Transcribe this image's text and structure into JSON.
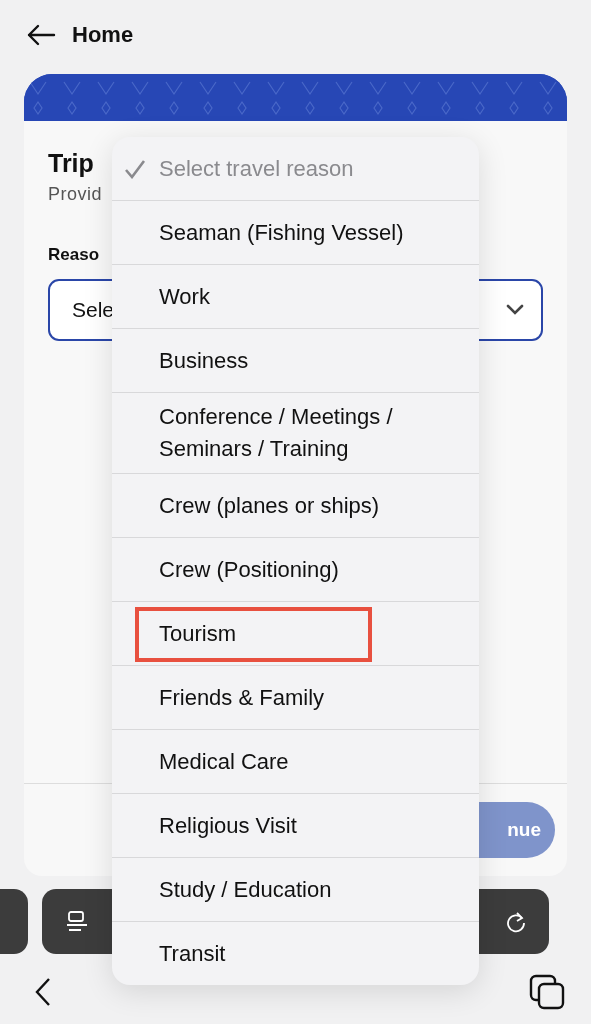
{
  "header": {
    "back_label": "Home"
  },
  "form": {
    "title": "Trip",
    "subtitle": "Provid",
    "field_label": "Reaso",
    "select_value": "Sele"
  },
  "continue_button": {
    "label": "nue",
    "disabled": true
  },
  "menu": {
    "items": [
      {
        "label": "Select travel reason",
        "kind": "placeholder",
        "selected": true,
        "highlighted": false
      },
      {
        "label": "Seaman (Fishing Vessel)",
        "kind": "option",
        "selected": false,
        "highlighted": false
      },
      {
        "label": "Work",
        "kind": "option",
        "selected": false,
        "highlighted": false
      },
      {
        "label": "Business",
        "kind": "option",
        "selected": false,
        "highlighted": false
      },
      {
        "label": "Conference / Meetings / Seminars / Training",
        "kind": "option",
        "selected": false,
        "highlighted": false
      },
      {
        "label": "Crew (planes or ships)",
        "kind": "option",
        "selected": false,
        "highlighted": false
      },
      {
        "label": "Crew (Positioning)",
        "kind": "option",
        "selected": false,
        "highlighted": false
      },
      {
        "label": "Tourism",
        "kind": "option",
        "selected": false,
        "highlighted": true
      },
      {
        "label": "Friends & Family",
        "kind": "option",
        "selected": false,
        "highlighted": false
      },
      {
        "label": "Medical Care",
        "kind": "option",
        "selected": false,
        "highlighted": false
      },
      {
        "label": "Religious Visit",
        "kind": "option",
        "selected": false,
        "highlighted": false
      },
      {
        "label": "Study / Education",
        "kind": "option",
        "selected": false,
        "highlighted": false
      },
      {
        "label": "Transit",
        "kind": "option",
        "selected": false,
        "highlighted": false
      }
    ]
  }
}
